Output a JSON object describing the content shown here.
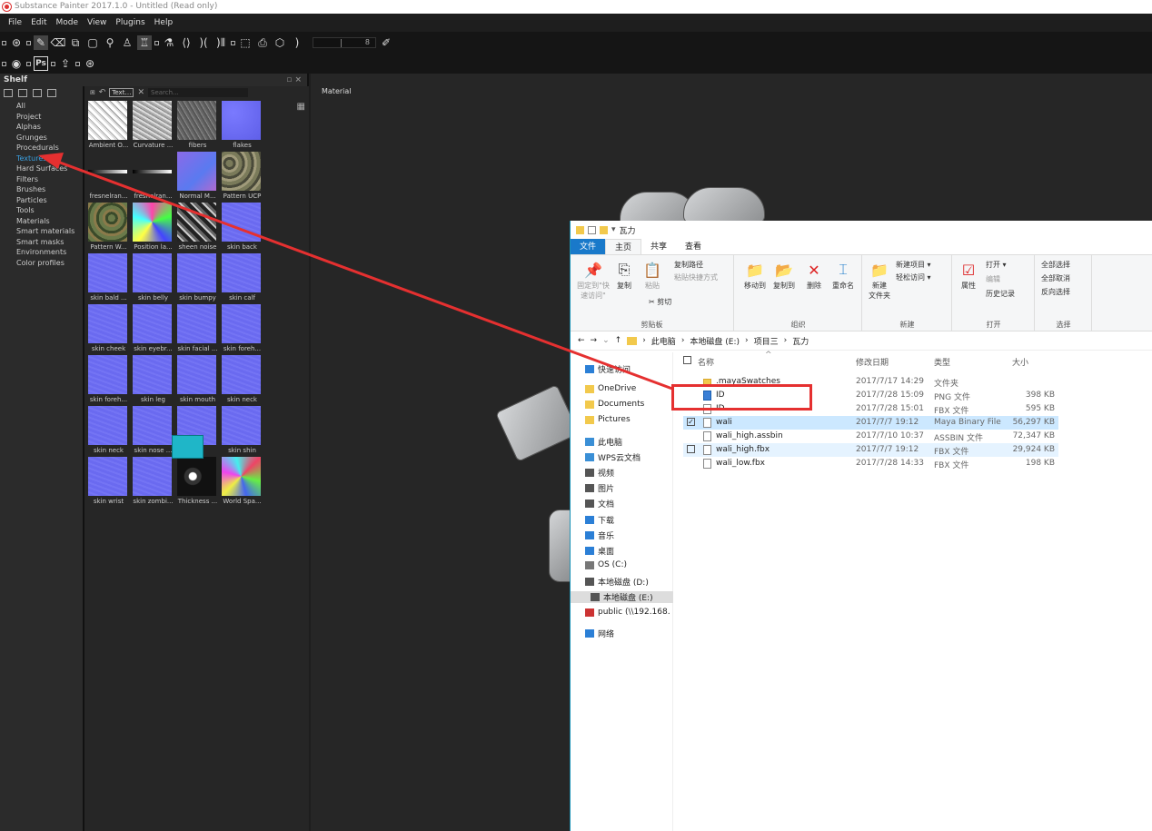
{
  "window": {
    "title": "Substance Painter 2017.1.0 - Untitled (Read only)"
  },
  "menu": [
    "File",
    "Edit",
    "Mode",
    "View",
    "Plugins",
    "Help"
  ],
  "toolbar": {
    "slider_value": "8"
  },
  "toolbar2": {
    "ps_label": "Ps"
  },
  "shelf": {
    "title": "Shelf",
    "categories": [
      "All",
      "Project",
      "Alphas",
      "Grunges",
      "Procedurals",
      "Textures",
      "Hard Surfaces",
      "Filters",
      "Brushes",
      "Particles",
      "Tools",
      "Materials",
      "Smart materials",
      "Smart masks",
      "Environments",
      "Color profiles"
    ],
    "filter_tag": "Text…",
    "search_placeholder": "Search...",
    "items": [
      {
        "label": "Ambient O...",
        "tex": "ao"
      },
      {
        "label": "Curvature ...",
        "tex": "curv"
      },
      {
        "label": "fibers",
        "tex": "fib"
      },
      {
        "label": "flakes",
        "tex": "flk"
      },
      {
        "label": "fresnelran...",
        "tex": "fres"
      },
      {
        "label": "fresnelran...",
        "tex": "fres"
      },
      {
        "label": "Normal M...",
        "tex": "norm"
      },
      {
        "label": "Pattern UCP",
        "tex": "camo"
      },
      {
        "label": "Pattern W...",
        "tex": "camo2"
      },
      {
        "label": "Position la...",
        "tex": "pos"
      },
      {
        "label": "sheen noise",
        "tex": "sheen"
      },
      {
        "label": "skin back",
        "tex": "skin"
      },
      {
        "label": "skin bald ...",
        "tex": "skin"
      },
      {
        "label": "skin belly",
        "tex": "skin"
      },
      {
        "label": "skin bumpy",
        "tex": "skin"
      },
      {
        "label": "skin calf",
        "tex": "skin"
      },
      {
        "label": "skin cheek",
        "tex": "skin"
      },
      {
        "label": "skin eyebr...",
        "tex": "skin"
      },
      {
        "label": "skin facial ...",
        "tex": "skin"
      },
      {
        "label": "skin foreh...",
        "tex": "skin"
      },
      {
        "label": "skin foreh...",
        "tex": "skin"
      },
      {
        "label": "skin leg",
        "tex": "skin"
      },
      {
        "label": "skin mouth",
        "tex": "skin"
      },
      {
        "label": "skin neck",
        "tex": "skin"
      },
      {
        "label": "skin neck",
        "tex": "skin"
      },
      {
        "label": "skin nose ...",
        "tex": "skin"
      },
      {
        "label": "",
        "tex": "skin"
      },
      {
        "label": "skin shin",
        "tex": "skin"
      },
      {
        "label": "skin wrist",
        "tex": "skin"
      },
      {
        "label": "skin zombi...",
        "tex": "skin"
      },
      {
        "label": "Thickness ...",
        "tex": "thick"
      },
      {
        "label": "World Spa...",
        "tex": "world"
      }
    ]
  },
  "viewport": {
    "label": "Material"
  },
  "explorer": {
    "title": "瓦力",
    "tabs": [
      "文件",
      "主页",
      "共享",
      "查看"
    ],
    "ribbon": {
      "pin": "固定到\"快速访问\"",
      "copy": "复制",
      "paste": "粘贴",
      "copy_path": "复制路径",
      "paste_shortcut": "粘贴快捷方式",
      "cut": "剪切",
      "clipboard_group": "剪贴板",
      "move_to": "移动到",
      "copy_to": "复制到",
      "delete": "删除",
      "rename": "重命名",
      "organize_group": "组织",
      "new_folder": "新建\n文件夹",
      "new_item": "新建项目 ▾",
      "easy_access": "轻松访问 ▾",
      "new_group": "新建",
      "properties": "属性",
      "open": "打开 ▾",
      "edit": "编辑",
      "history": "历史记录",
      "open_group": "打开",
      "select_all": "全部选择",
      "select_none": "全部取消",
      "invert": "反向选择",
      "select_group": "选择"
    },
    "breadcrumb": [
      "此电脑",
      "本地磁盘 (E:)",
      "项目三",
      "瓦力"
    ],
    "nav": [
      {
        "label": "快速访问",
        "color": "#2b7fd6"
      },
      {
        "label": "OneDrive",
        "color": "#f2c94c"
      },
      {
        "label": "Documents",
        "color": "#f2c94c"
      },
      {
        "label": "Pictures",
        "color": "#f2c94c"
      },
      {
        "label": "此电脑",
        "color": "#3a8fd6"
      },
      {
        "label": "WPS云文档",
        "color": "#3a8fd6"
      },
      {
        "label": "视频",
        "color": "#555"
      },
      {
        "label": "图片",
        "color": "#555"
      },
      {
        "label": "文档",
        "color": "#555"
      },
      {
        "label": "下载",
        "color": "#2b7fd6"
      },
      {
        "label": "音乐",
        "color": "#2b7fd6"
      },
      {
        "label": "桌面",
        "color": "#2b7fd6"
      },
      {
        "label": "OS (C:)",
        "color": "#777"
      },
      {
        "label": "本地磁盘 (D:)",
        "color": "#555"
      },
      {
        "label": "本地磁盘 (E:)",
        "color": "#555"
      },
      {
        "label": "public (\\\\192.168.",
        "color": "#c33"
      },
      {
        "label": "网络",
        "color": "#2b7fd6"
      }
    ],
    "columns": {
      "name": "名称",
      "date": "修改日期",
      "type": "类型",
      "size": "大小"
    },
    "files": [
      {
        "name": ".mayaSwatches",
        "date": "2017/7/17 14:29",
        "type": "文件夹",
        "size": "",
        "kind": "folder"
      },
      {
        "name": "ID",
        "date": "2017/7/28 15:09",
        "type": "PNG 文件",
        "size": "398 KB",
        "kind": "img"
      },
      {
        "name": "ID",
        "date": "2017/7/28 15:01",
        "type": "FBX 文件",
        "size": "595 KB",
        "kind": "file"
      },
      {
        "name": "wali",
        "date": "2017/7/7 19:12",
        "type": "Maya Binary File",
        "size": "56,297 KB",
        "kind": "file"
      },
      {
        "name": "wali_high.assbin",
        "date": "2017/7/10 10:37",
        "type": "ASSBIN 文件",
        "size": "72,347 KB",
        "kind": "file"
      },
      {
        "name": "wali_high.fbx",
        "date": "2017/7/7 19:12",
        "type": "FBX 文件",
        "size": "29,924 KB",
        "kind": "file"
      },
      {
        "name": "wali_low.fbx",
        "date": "2017/7/28 14:33",
        "type": "FBX 文件",
        "size": "198 KB",
        "kind": "file"
      }
    ]
  },
  "colors": {
    "accent": "#3ba0e0",
    "annotation": "#e53030",
    "explorer_border": "#1d94b8",
    "drag_preview": "#1fb6c8"
  }
}
